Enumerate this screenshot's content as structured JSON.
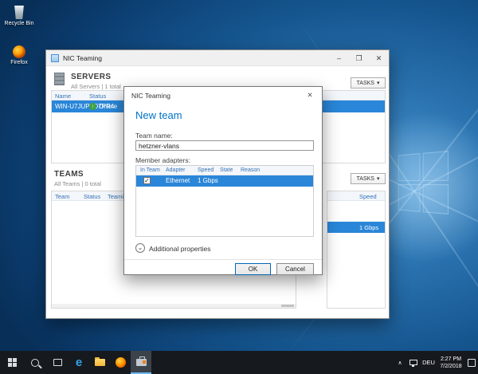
{
  "glyphs": {
    "check": "✓",
    "dropdown": "▾",
    "close": "✕",
    "minimize": "–",
    "maximize": "❐",
    "chevron_circle": "⌄",
    "status_up": "↑",
    "tray_chevron": "∧"
  },
  "desktop": {
    "icons": [
      {
        "label": "Recycle Bin"
      },
      {
        "label": "Firefox"
      }
    ]
  },
  "window": {
    "title": "NIC Teaming",
    "servers": {
      "title": "SERVERS",
      "subtitle": "All Servers | 1 total",
      "tasks_label": "TASKS",
      "col_name": "Name",
      "col_status": "Status",
      "row": {
        "name": "WIN-U7JUP5O7PR4",
        "status": "Online"
      }
    },
    "teams": {
      "title": "TEAMS",
      "subtitle": "All Teams | 0 total",
      "col_team": "Team",
      "col_status": "Status",
      "col_teaming_mode": "Teaming Mo",
      "tasks_label": "TASKS"
    },
    "adapters": {
      "tasks_label": "TASKS",
      "col_speed": "Speed",
      "row": {
        "speed": "1 Gbps"
      }
    }
  },
  "dialog": {
    "title": "NIC Teaming",
    "heading": "New team",
    "team_name_label": "Team name:",
    "team_name_value": "hetzner-vlans",
    "member_adapters_label": "Member adapters:",
    "col_in_team": "In Team",
    "col_adapter": "Adapter",
    "col_speed": "Speed",
    "col_state": "State",
    "col_reason": "Reason",
    "row": {
      "adapter": "Ethernet",
      "speed": "1 Gbps"
    },
    "additional_properties_label": "Additional properties",
    "ok_label": "OK",
    "cancel_label": "Cancel"
  },
  "taskbar": {
    "tray": {
      "language": "DEU",
      "time": "2:27 PM",
      "date": "7/2/2018"
    }
  }
}
